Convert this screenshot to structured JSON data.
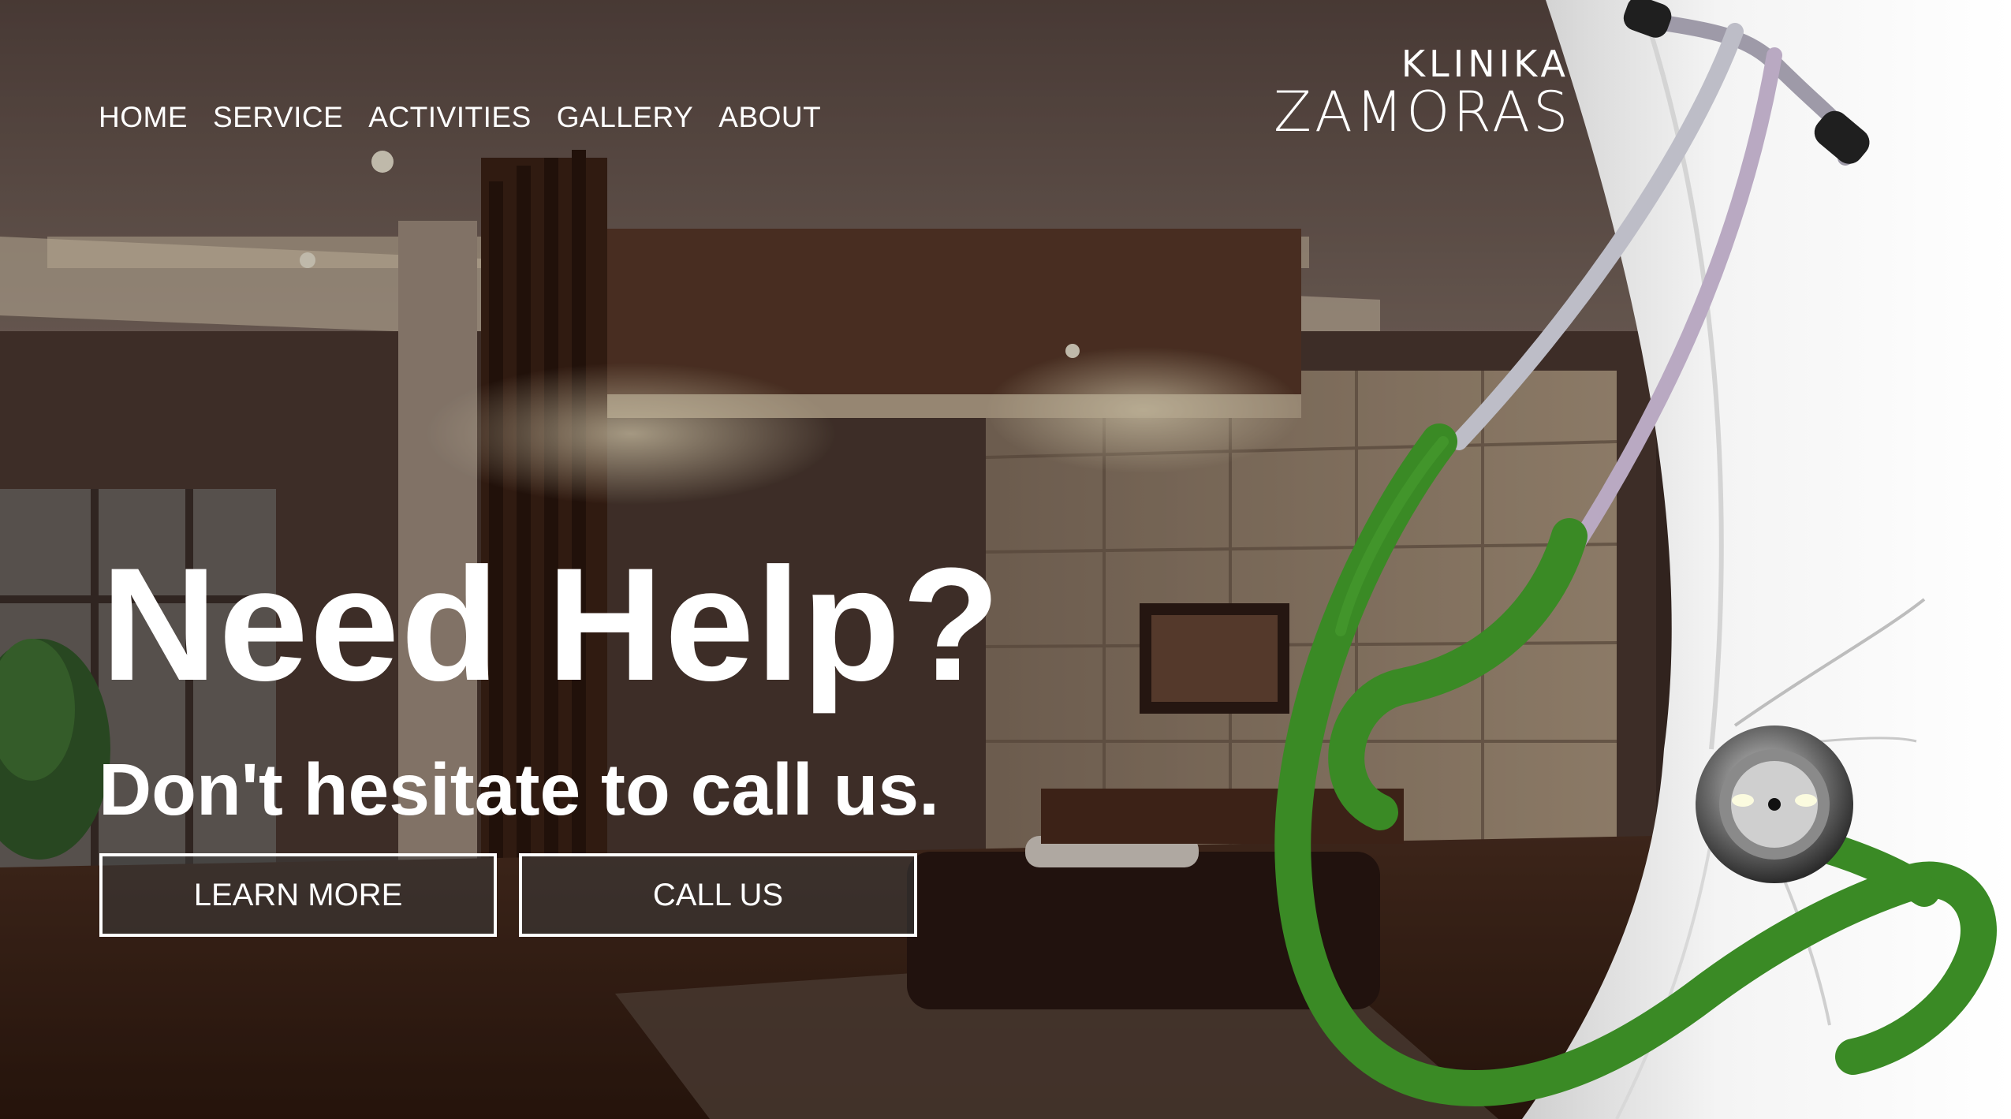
{
  "nav": {
    "items": [
      {
        "label": "HOME"
      },
      {
        "label": "SERVICE"
      },
      {
        "label": "ACTIVITIES"
      },
      {
        "label": "GALLERY"
      },
      {
        "label": "ABOUT"
      }
    ]
  },
  "logo": {
    "line1": "KLINIKA",
    "line2": "ZAMORAS"
  },
  "hero": {
    "headline": "Need Help?",
    "subheadline": "Don't hesitate to call us.",
    "buttons": {
      "learn_more": "LEARN MORE",
      "call_us": "CALL US"
    }
  },
  "colors": {
    "text": "#ffffff",
    "button_border": "#ffffff",
    "stethoscope_tube": "#3a8a25",
    "curtain": "#f2f2f2"
  },
  "icons": {
    "hero_image": "living-room-interior-photo",
    "decoration": "stethoscope-icon"
  }
}
